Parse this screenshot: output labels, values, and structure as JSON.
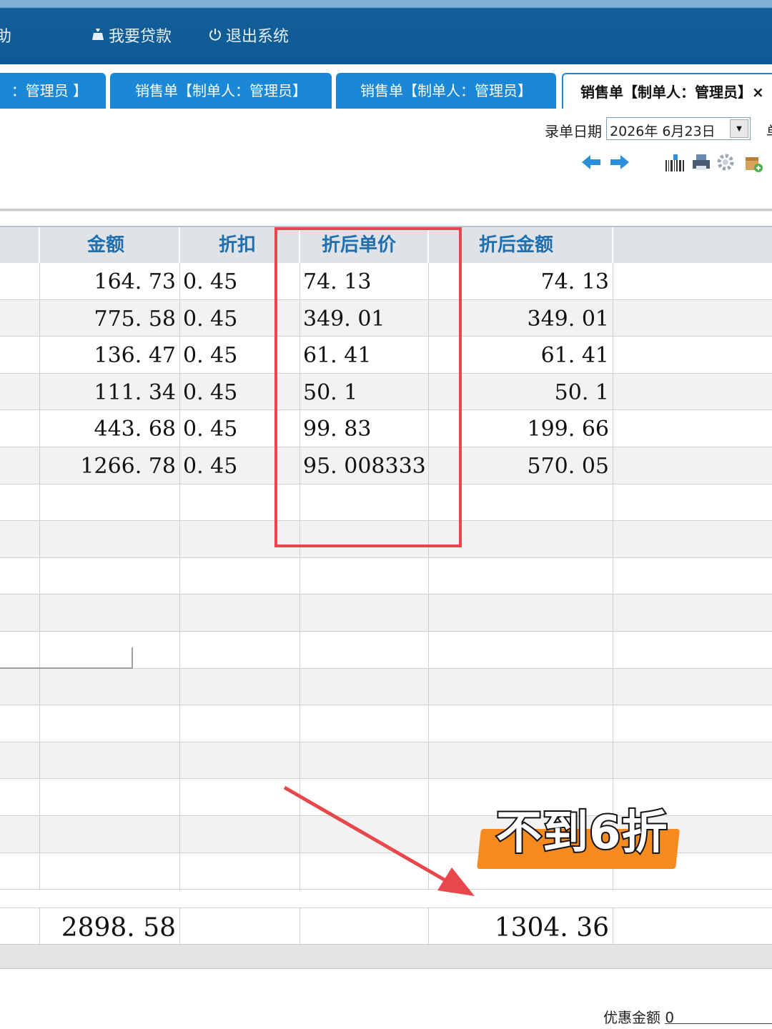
{
  "topbar": {
    "partial_left": "助",
    "loan_label": "我要贷款",
    "logout_label": "退出系统"
  },
  "tabs": [
    {
      "label": "：管理员 】"
    },
    {
      "label": "销售单【制单人：管理员】"
    },
    {
      "label": "销售单【制单人：管理员】"
    },
    {
      "label": "销售单【制单人：管理员】×"
    }
  ],
  "form": {
    "date_label": "录单日期",
    "date_value": "2026年  6月23日",
    "right_clipped": "单"
  },
  "toolbar": {
    "icons": [
      "arrow-left-icon",
      "arrow-right-icon",
      "barcode-icon",
      "print-icon",
      "settings-icon",
      "export-icon"
    ]
  },
  "columns": {
    "amount": "金额",
    "discount": "折扣",
    "unit_after": "折后单价",
    "amount_after": "折后金额"
  },
  "rows": [
    {
      "amount": "164. 73",
      "discount": "0. 45",
      "unit_after": "74. 13",
      "amount_after": "74. 13"
    },
    {
      "amount": "775. 58",
      "discount": "0. 45",
      "unit_after": "349. 01",
      "amount_after": "349. 01"
    },
    {
      "amount": "136. 47",
      "discount": "0. 45",
      "unit_after": "61. 41",
      "amount_after": "61. 41"
    },
    {
      "amount": "111. 34",
      "discount": "0. 45",
      "unit_after": "50. 1",
      "amount_after": "50. 1"
    },
    {
      "amount": "443. 68",
      "discount": "0. 45",
      "unit_after": "99. 83",
      "amount_after": "199. 66"
    },
    {
      "amount": "1266. 78",
      "discount": "0. 45",
      "unit_after": "95. 0083333",
      "amount_after": "570. 05"
    }
  ],
  "totals": {
    "amount": "2898. 58",
    "amount_after": "1304. 36"
  },
  "footer": {
    "discount_label": "优惠金额",
    "discount_value": "0"
  },
  "annotation": {
    "callout": "不到6折",
    "highlight_color": "#e8474c",
    "callout_color": "#f58a1f"
  },
  "colors": {
    "topbar": "#0d5a94",
    "tab": "#1a88d6",
    "header_text": "#1d6fb0"
  }
}
